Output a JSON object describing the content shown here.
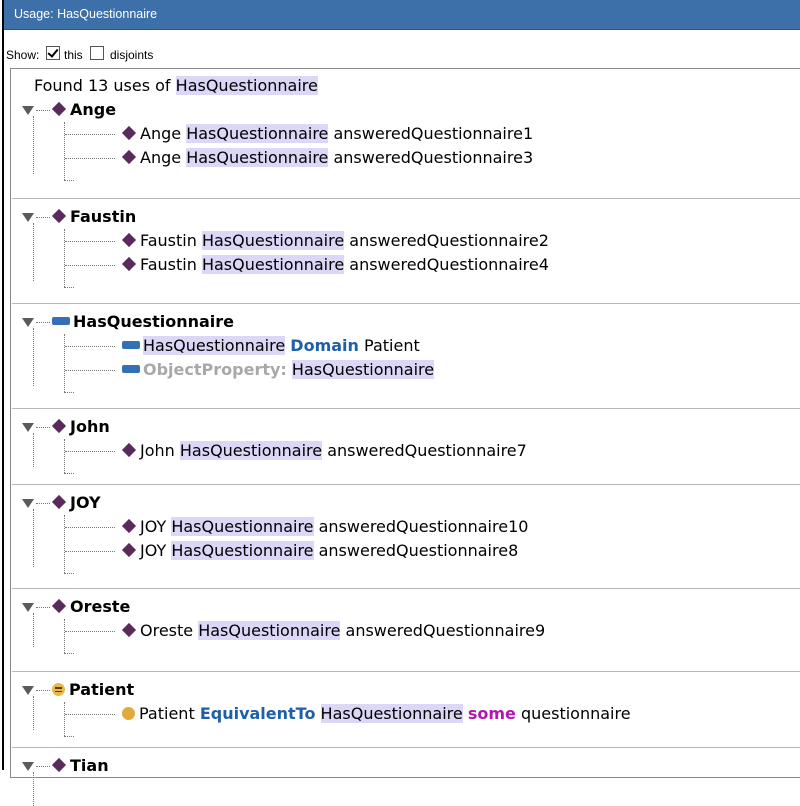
{
  "window": {
    "title": "Usage: HasQuestionnaire"
  },
  "show": {
    "label": "Show:",
    "this_label": "this",
    "this_checked": true,
    "disjoints_label": "disjoints",
    "disjoints_checked": false
  },
  "found": {
    "prefix": "Found 13 uses of",
    "term": "HasQuestionnaire"
  },
  "groups": [
    {
      "name": "Ange",
      "icon": "individual-diamond-icon",
      "items": [
        {
          "subject": "Ange",
          "property": "HasQuestionnaire",
          "object": "answeredQuestionnaire1"
        },
        {
          "subject": "Ange",
          "property": "HasQuestionnaire",
          "object": "answeredQuestionnaire3"
        }
      ]
    },
    {
      "name": "Faustin",
      "icon": "individual-diamond-icon",
      "items": [
        {
          "subject": "Faustin",
          "property": "HasQuestionnaire",
          "object": "answeredQuestionnaire2"
        },
        {
          "subject": "Faustin",
          "property": "HasQuestionnaire",
          "object": "answeredQuestionnaire4"
        }
      ]
    },
    {
      "name": "HasQuestionnaire",
      "icon": "object-property-icon",
      "items": [
        {
          "subject": "HasQuestionnaire",
          "keyword": "Domain",
          "object": "Patient"
        },
        {
          "keyword_gray": "ObjectProperty:",
          "object": "HasQuestionnaire"
        }
      ]
    },
    {
      "name": "John",
      "icon": "individual-diamond-icon",
      "items": [
        {
          "subject": "John",
          "property": "HasQuestionnaire",
          "object": "answeredQuestionnaire7"
        }
      ]
    },
    {
      "name": "JOY",
      "icon": "individual-diamond-icon",
      "items": [
        {
          "subject": "JOY",
          "property": "HasQuestionnaire",
          "object": "answeredQuestionnaire10"
        },
        {
          "subject": "JOY",
          "property": "HasQuestionnaire",
          "object": "answeredQuestionnaire8"
        }
      ]
    },
    {
      "name": "Oreste",
      "icon": "individual-diamond-icon",
      "items": [
        {
          "subject": "Oreste",
          "property": "HasQuestionnaire",
          "object": "answeredQuestionnaire9"
        }
      ]
    },
    {
      "name": "Patient",
      "icon": "class-equivalent-icon",
      "items": [
        {
          "subject": "Patient",
          "keyword": "EquivalentTo",
          "property": "HasQuestionnaire",
          "some": "some",
          "object": "questionnaire"
        }
      ]
    },
    {
      "name": "Tian",
      "icon": "individual-diamond-icon",
      "items": []
    }
  ],
  "colors": {
    "titlebar": "#3d6fa8",
    "highlight": "#dcd6f7",
    "individual": "#5b2a5d",
    "property": "#3570b5",
    "keyword_blue": "#1e5fa8",
    "keyword_purple": "#b316b3",
    "class": "#e2a93b"
  }
}
